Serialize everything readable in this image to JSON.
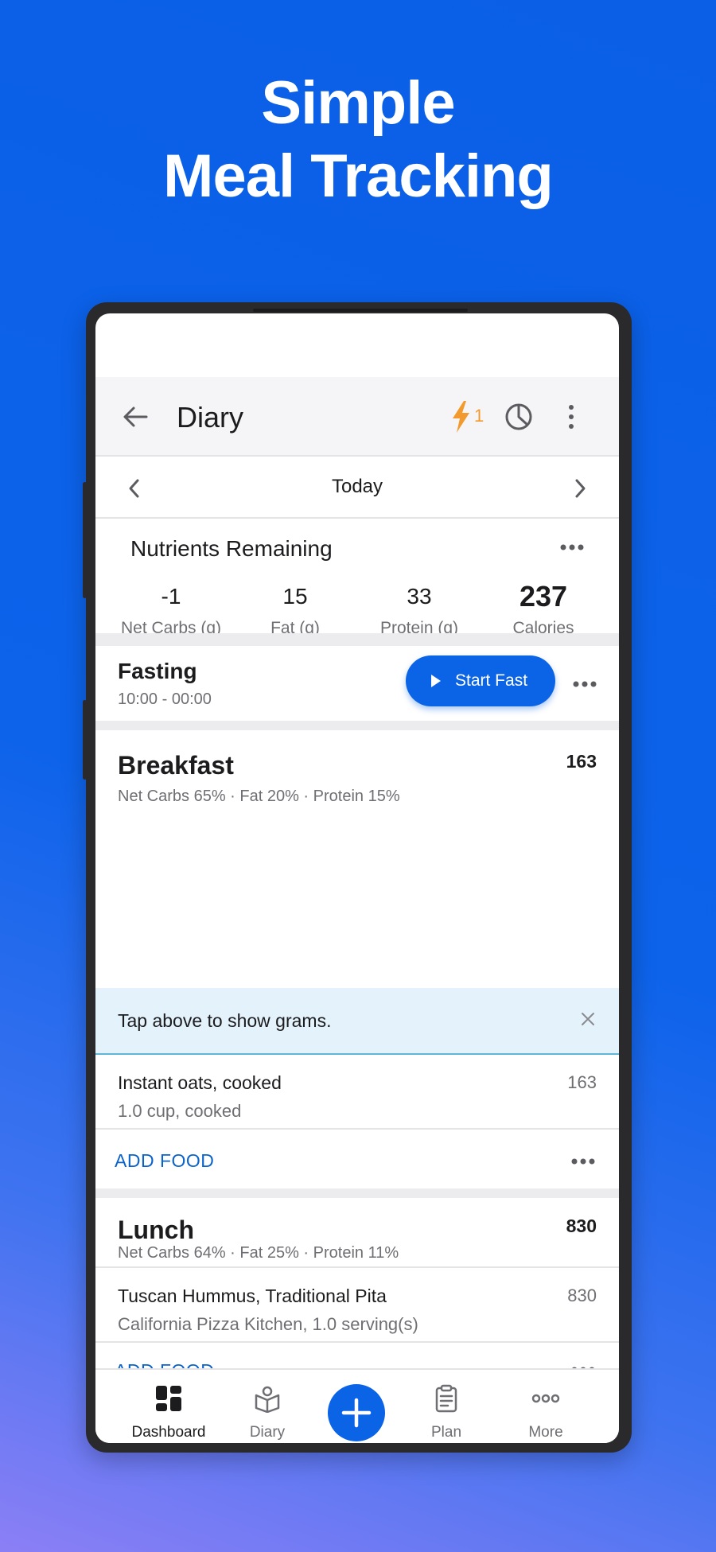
{
  "promo": {
    "line1": "Simple",
    "line2": "Meal Tracking"
  },
  "appbar": {
    "title": "Diary",
    "streak_count": "1"
  },
  "date_nav": {
    "label": "Today"
  },
  "nutrients": {
    "heading": "Nutrients Remaining",
    "items": [
      {
        "value": "-1",
        "label": "Net Carbs (g)"
      },
      {
        "value": "15",
        "label": "Fat (g)"
      },
      {
        "value": "33",
        "label": "Protein (g)"
      },
      {
        "value": "237",
        "label": "Calories"
      }
    ]
  },
  "fasting": {
    "title": "Fasting",
    "schedule": "10:00 - 00:00",
    "button": "Start Fast"
  },
  "breakfast": {
    "name": "Breakfast",
    "calories": "163",
    "macros": "Net Carbs 65% · Fat 20% · Protein 15%",
    "tip": "Tap above to show grams.",
    "foods": [
      {
        "name": "Instant oats, cooked",
        "detail": "1.0 cup, cooked",
        "calories": "163"
      }
    ],
    "add_label": "ADD FOOD"
  },
  "lunch": {
    "name": "Lunch",
    "calories": "830",
    "macros": "Net Carbs 64% · Fat 25% · Protein 11%",
    "foods": [
      {
        "name": "Tuscan Hummus, Traditional Pita",
        "detail": "California Pizza Kitchen, 1.0 serving(s)",
        "calories": "830"
      }
    ],
    "add_label": "ADD FOOD"
  },
  "bottom_nav": {
    "tabs": [
      {
        "label": "Dashboard",
        "icon": "dashboard-icon"
      },
      {
        "label": "Diary",
        "icon": "diary-icon"
      },
      {
        "label": "Plan",
        "icon": "plan-icon"
      },
      {
        "label": "More",
        "icon": "more-icon"
      }
    ],
    "active": "Dashboard"
  },
  "colors": {
    "accent": "#0b63e5",
    "streak": "#f29a2e",
    "tip_bg": "#e3f2fb"
  }
}
